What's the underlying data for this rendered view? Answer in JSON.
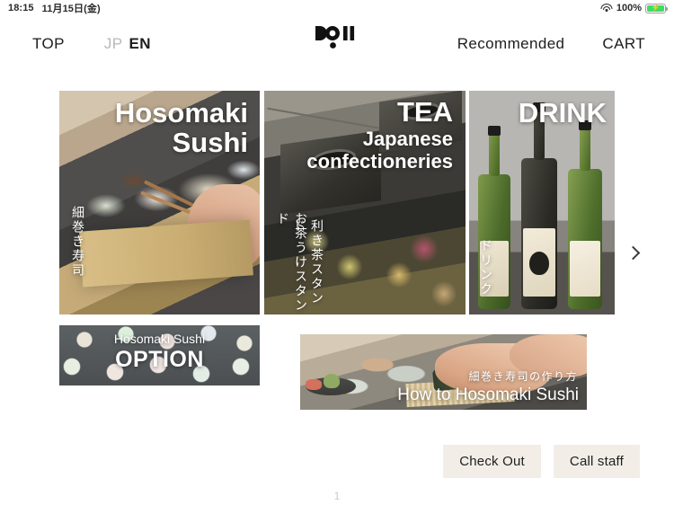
{
  "statusbar": {
    "time": "18:15",
    "date": "11月15日(金)",
    "battery_percent": "100%",
    "wifi_icon": "wifi-icon",
    "battery_icon": "battery-charging-icon"
  },
  "navbar": {
    "top_label": "TOP",
    "lang_jp": "JP",
    "lang_en": "EN",
    "recommended_label": "Recommended",
    "cart_label": "CART",
    "logo_alt": "DO!!"
  },
  "cards": [
    {
      "id": "card1",
      "title_en": "Hosomaki\nSushi",
      "title_jp": "細巻き寿司"
    },
    {
      "id": "card2",
      "title_en": "TEA",
      "subtitle_en": "Japanese\nconfectioneries",
      "title_jp_1": "利き茶スタンド",
      "title_jp_2": "お茶うけスタンド"
    },
    {
      "id": "card3",
      "title_en": "DRINK",
      "title_jp": "ドリンク"
    },
    {
      "id": "card4",
      "small_label": "Hosomaki Sushi",
      "big_label": "OPTION"
    },
    {
      "id": "card5",
      "title_jp": "細巻き寿司の作り方",
      "title_en": "How to Hosomaki Sushi"
    }
  ],
  "carousel": {
    "next_icon": "chevron-right-icon",
    "page_indicator": "1"
  },
  "footer": {
    "checkout_label": "Check Out",
    "call_staff_label": "Call staff"
  },
  "colors": {
    "background": "#ffffff",
    "button_bg": "#f2ede7",
    "text": "#1d1d1d",
    "inactive": "#b8b8b8",
    "battery_green": "#3ddc63",
    "page_indicator": "#cccccc"
  }
}
